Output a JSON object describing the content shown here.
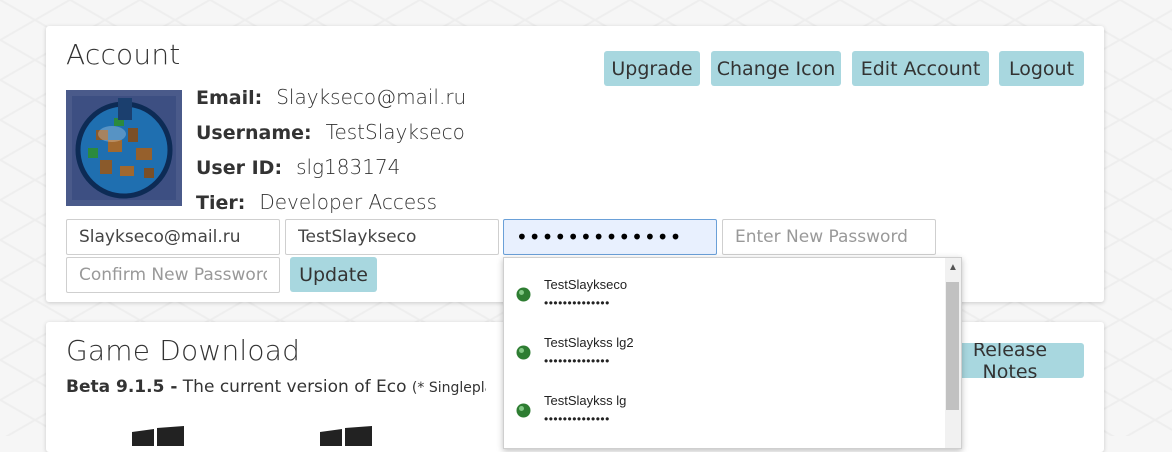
{
  "account": {
    "title": "Account",
    "buttons": {
      "upgrade": "Upgrade",
      "change_icon": "Change Icon",
      "edit_account": "Edit Account",
      "logout": "Logout",
      "update": "Update"
    },
    "info": {
      "email_label": "Email:",
      "email_value": "Slaykseco@mail.ru",
      "username_label": "Username:",
      "username_value": "TestSlaykseco",
      "userid_label": "User ID:",
      "userid_value": "slg183174",
      "tier_label": "Tier:",
      "tier_value": "Developer Access"
    },
    "form": {
      "email_value": "Slaykseco@mail.ru",
      "username_value": "TestSlaykseco",
      "password_value": "•••••••••••••",
      "new_password_placeholder": "Enter New Password",
      "confirm_password_placeholder": "Confirm New Password"
    }
  },
  "download": {
    "title": "Game Download",
    "version": "Beta 9.1.5 -",
    "description": "The current version of Eco",
    "note": "(* Singleplayer not su",
    "release_notes_button": "Release Notes"
  },
  "autofill": {
    "items": [
      {
        "username": "TestSlaykseco",
        "password": "••••••••••••••"
      },
      {
        "username": "TestSlaykss lg2",
        "password": "••••••••••••••"
      },
      {
        "username": "TestSlaykss lg",
        "password": "••••••••••••••"
      }
    ]
  },
  "colors": {
    "button_bg": "#a8d7df",
    "focused_input_bg": "#e8f0fe"
  }
}
